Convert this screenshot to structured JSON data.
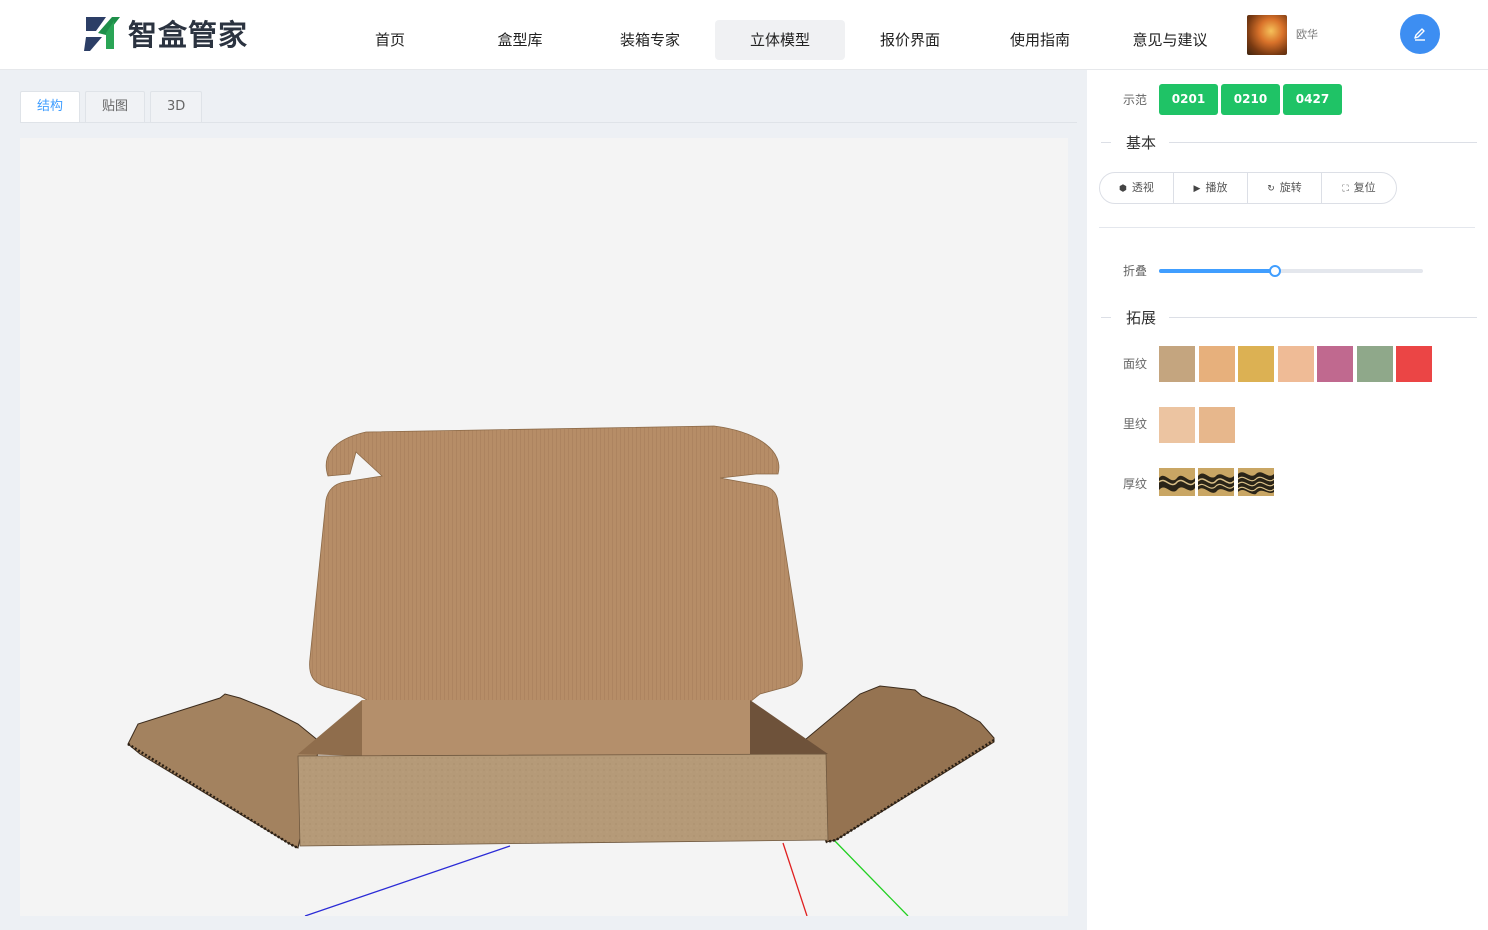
{
  "header": {
    "logo_text": "智盒管家",
    "nav": [
      {
        "label": "首页",
        "active": false
      },
      {
        "label": "盒型库",
        "active": false
      },
      {
        "label": "装箱专家",
        "active": false
      },
      {
        "label": "立体模型",
        "active": true
      },
      {
        "label": "报价界面",
        "active": false
      },
      {
        "label": "使用指南",
        "active": false
      },
      {
        "label": "意见与建议",
        "active": false
      }
    ],
    "username": "欧华",
    "edit_icon": "pencil-icon"
  },
  "tabs": [
    {
      "label": "结构",
      "active": true
    },
    {
      "label": "贴图",
      "active": false
    },
    {
      "label": "3D",
      "active": false
    }
  ],
  "panel": {
    "demo_label": "示范",
    "demos": [
      "0201",
      "0210",
      "0427"
    ],
    "demo_color": "#1fc366",
    "basic_title": "基本",
    "buttons": [
      {
        "icon": "cube-icon",
        "label": "透视"
      },
      {
        "icon": "play-icon",
        "label": "播放"
      },
      {
        "icon": "rotate-icon",
        "label": "旋转"
      },
      {
        "icon": "fullscreen-icon",
        "label": "复位"
      }
    ],
    "fold_label": "折叠",
    "fold_value": 0.44,
    "extend_title": "拓展",
    "face_label": "面纹",
    "face_colors": [
      "#c4a57f",
      "#e7b07c",
      "#dcb153",
      "#efbb96",
      "#c0698f",
      "#8fa88a",
      "#eb4545"
    ],
    "inner_label": "里纹",
    "inner_colors": [
      "#ecc4a1",
      "#e7b78c"
    ],
    "thick_label": "厚纹",
    "accent": "#409eff"
  }
}
